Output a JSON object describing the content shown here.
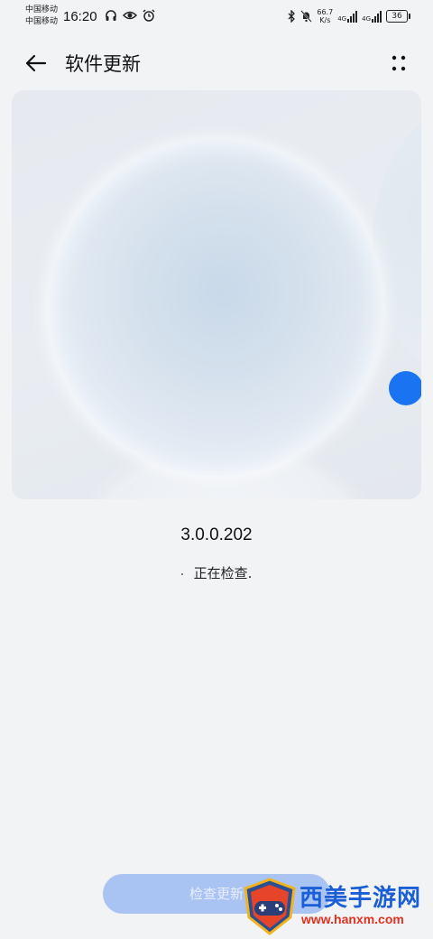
{
  "status_bar": {
    "carrier_1": "中国移动",
    "carrier_2": "中国移动",
    "time": "16:20",
    "left_icons": [
      "headphones-icon",
      "eye-icon",
      "alarm-icon"
    ],
    "net_speed_value": "66.7",
    "net_speed_unit": "K/s",
    "signal_1_label": "4G",
    "signal_2_label": "4G",
    "battery_level": "36",
    "right_icons": [
      "bluetooth-icon",
      "mute-bell-icon"
    ]
  },
  "header": {
    "title": "软件更新",
    "back_icon": "arrow-left-icon",
    "more_icon": "more-dots-icon"
  },
  "hero": {
    "accent_color": "#1a73f0"
  },
  "update": {
    "version": "3.0.0.202",
    "status": "正在检查."
  },
  "actions": {
    "check_update_label": "检查更新"
  },
  "watermark": {
    "text": "西美手游网",
    "url": "www.hanxm.com"
  }
}
